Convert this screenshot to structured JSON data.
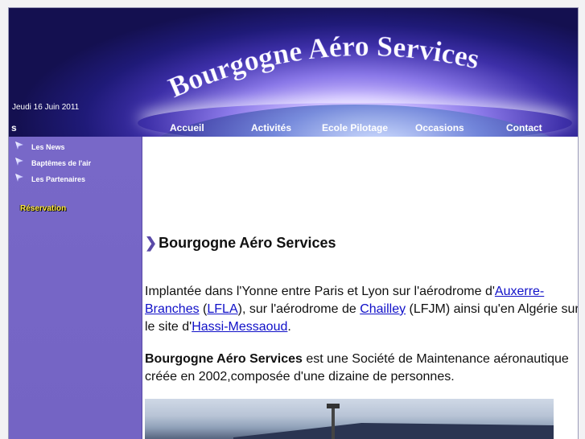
{
  "banner": {
    "title": "Bourgogne Aéro Services",
    "date": "Jeudi 16 Juin 2011",
    "nav_cut": "s"
  },
  "nav": {
    "items": [
      {
        "label": "Accueil"
      },
      {
        "label": "Activités"
      },
      {
        "label": "Ecole Pilotage"
      },
      {
        "label": "Occasions"
      },
      {
        "label": "Contact"
      }
    ]
  },
  "sidebar": {
    "links": [
      {
        "label": "Les News",
        "icon": "bullet-arrow-icon"
      },
      {
        "label": "Baptêmes de l'air",
        "icon": "bullet-arrow-icon"
      },
      {
        "label": "Les Partenaires",
        "icon": "bullet-arrow-icon"
      }
    ],
    "reservation": "Réservation"
  },
  "content": {
    "heading": "Bourgogne Aéro Services",
    "para1": {
      "t1": "Implantée dans l'Yonne entre Paris et Lyon sur l'aérodrome d'",
      "l1": "Auxerre-Branches",
      "t2": " (",
      "l2": "LFLA",
      "t3": "), sur l'aérodrome de ",
      "l3": "Chailley",
      "t4": " (LFJM) ainsi qu'en Algérie sur le site d'",
      "l4": "Hassi-Messaoud",
      "t5": "."
    },
    "para2": {
      "bold": "Bourgogne Aéro Services",
      "rest": " est une Société de Maintenance aéronautique créée en 2002,composée d'une dizaine de personnes."
    }
  },
  "colors": {
    "sidebar": "#7868c8",
    "banner_dark": "#1f1a78",
    "link": "#1010c8",
    "reservation": "#ffe840"
  }
}
